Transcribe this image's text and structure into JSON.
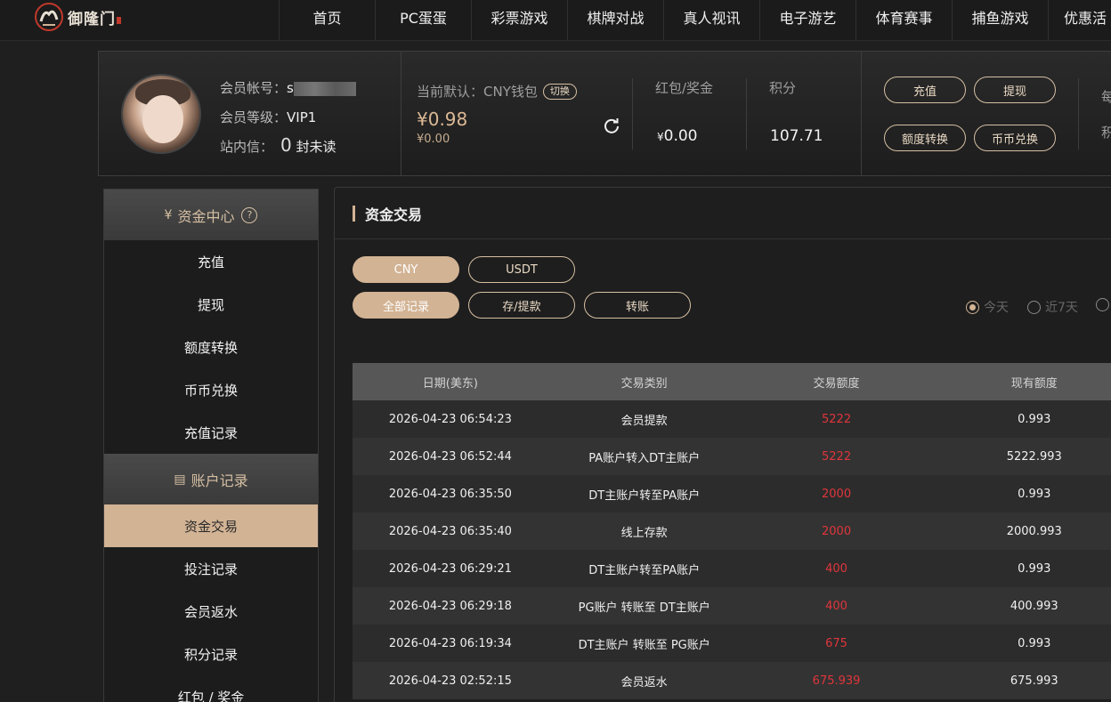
{
  "brand": {
    "name": "御隆门"
  },
  "nav": [
    "首页",
    "PC蛋蛋",
    "彩票游戏",
    "棋牌对战",
    "真人视讯",
    "电子游艺",
    "体育赛事",
    "捕鱼游戏",
    "优惠活"
  ],
  "member": {
    "account_label": "会员帐号：",
    "account_value": "s",
    "level_label": "会员等级：",
    "level_value": "VIP1",
    "inbox_label": "站内信：",
    "inbox_count": "0",
    "inbox_suffix": "封未读"
  },
  "wallet": {
    "label": "当前默认：CNY钱包",
    "switch_label": "切换",
    "balance": "¥0.98",
    "sub_balance": "¥0.00"
  },
  "stats": {
    "bonus_label": "红包/奖金",
    "bonus_currency": "¥",
    "bonus_value": "0.00",
    "points_label": "积分",
    "points_value": "107.71"
  },
  "actions": {
    "deposit": "充值",
    "withdraw": "提现",
    "transfer": "额度转换",
    "exchange": "币币兑换"
  },
  "right_cut": {
    "line1": "每",
    "line2": "积"
  },
  "sidebar": {
    "fund_center": "资金中心",
    "fund_items": [
      "充值",
      "提现",
      "额度转换",
      "币币兑换",
      "充值记录"
    ],
    "account_records": "账户记录",
    "record_items": [
      "资金交易",
      "投注记录",
      "会员返水",
      "积分记录",
      "红包 / 奖金"
    ]
  },
  "main": {
    "title": "资金交易",
    "currency_tabs": [
      "CNY",
      "USDT"
    ],
    "type_tabs": [
      "全部记录",
      "存/提款",
      "转账"
    ],
    "range_options": [
      "今天",
      "近7天"
    ]
  },
  "table": {
    "headers": [
      "日期(美东)",
      "交易类别",
      "交易额度",
      "现有额度"
    ],
    "rows": [
      [
        "2026-04-23 06:54:23",
        "会员提款",
        "5222",
        "0.993"
      ],
      [
        "2026-04-23 06:52:44",
        "PA账户转入DT主账户",
        "5222",
        "5222.993"
      ],
      [
        "2026-04-23 06:35:50",
        "DT主账户转至PA账户",
        "2000",
        "0.993"
      ],
      [
        "2026-04-23 06:35:40",
        "线上存款",
        "2000",
        "2000.993"
      ],
      [
        "2026-04-23 06:29:21",
        "DT主账户转至PA账户",
        "400",
        "0.993"
      ],
      [
        "2026-04-23 06:29:18",
        "PG账户 转账至 DT主账户",
        "400",
        "400.993"
      ],
      [
        "2026-04-23 06:19:34",
        "DT主账户 转账至 PG账户",
        "675",
        "0.993"
      ],
      [
        "2026-04-23 02:52:15",
        "会员返水",
        "675.939",
        "675.993"
      ]
    ]
  },
  "colors": {
    "accent": "#d2b394",
    "amount": "#e0353b",
    "bg": "#1f1f1f"
  }
}
